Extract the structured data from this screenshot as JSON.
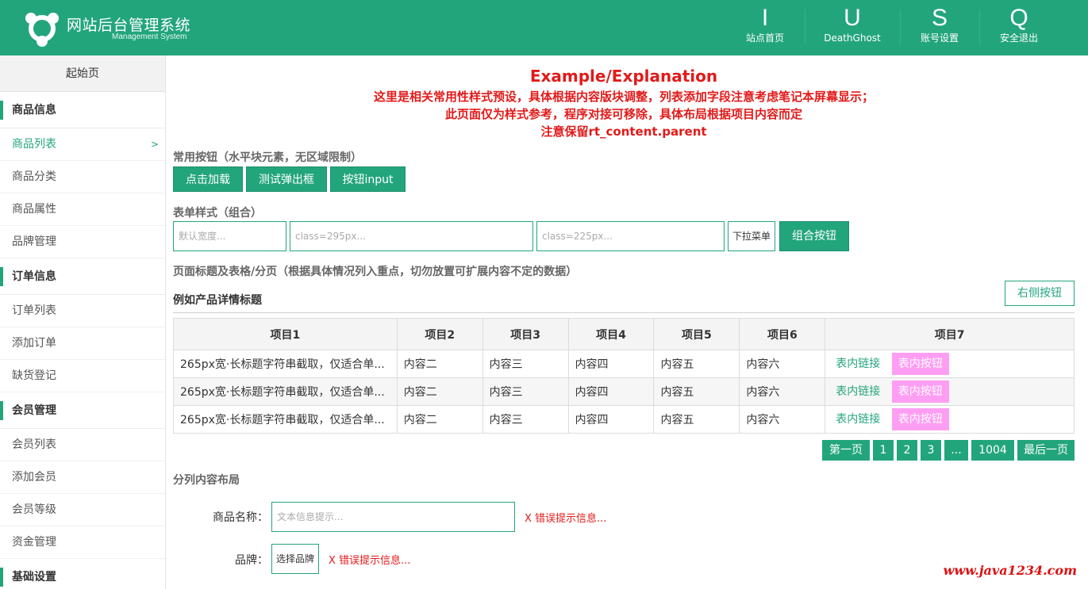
{
  "header": {
    "title": "网站后台管理系统",
    "subtitle": "Management System",
    "nav": [
      {
        "glyph": "I",
        "label": "站点首页",
        "icon": "home-icon"
      },
      {
        "glyph": "U",
        "label": "DeathGhost",
        "icon": "user-icon"
      },
      {
        "glyph": "S",
        "label": "账号设置",
        "icon": "settings-icon"
      },
      {
        "glyph": "Q",
        "label": "安全退出",
        "icon": "logout-icon"
      }
    ],
    "brand_color": "#23a57c"
  },
  "sidebar": {
    "home": "起始页",
    "groups": [
      {
        "title": "商品信息",
        "items": [
          "商品列表",
          "商品分类",
          "商品属性",
          "品牌管理"
        ]
      },
      {
        "title": "订单信息",
        "items": [
          "订单列表",
          "添加订单",
          "缺货登记"
        ]
      },
      {
        "title": "会员管理",
        "items": [
          "会员列表",
          "添加会员",
          "会员等级",
          "资金管理"
        ]
      },
      {
        "title": "基础设置",
        "items": []
      }
    ],
    "active_item": "商品列表",
    "active_arrow": ">"
  },
  "explanation": {
    "title": "Example/Explanation",
    "lines": [
      "这里是相关常用性样式预设，具体根据内容版块调整，列表添加字段注意考虑笔记本屏幕显示；",
      "此页面仅为样式参考，程序对接可移除，具体布局根据项目内容而定",
      "注意保留rt_content.parent"
    ]
  },
  "buttons_section": {
    "title": "常用按钮（水平块元素，无区域限制）",
    "buttons": [
      "点击加载",
      "测试弹出框",
      "按钮input"
    ]
  },
  "form_section": {
    "title": "表单样式（组合）",
    "placeholders": [
      "默认宽度...",
      "class=295px...",
      "class=225px..."
    ],
    "select_value": "下拉菜单",
    "group_button": "组合按钮"
  },
  "table_section": {
    "title": "页面标题及表格/分页（根据具体情况列入重点，切勿放置可扩展内容不定的数据）",
    "detail_title": "例如产品详情标题",
    "right_button": "右侧按钮",
    "columns": [
      "项目1",
      "项目2",
      "项目3",
      "项目4",
      "项目5",
      "项目6",
      "项目7"
    ],
    "rows": [
      {
        "c1": "265px宽·长标题字符串截取，仅适合单...",
        "c2": "内容二",
        "c3": "内容三",
        "c4": "内容四",
        "c5": "内容五",
        "c6": "内容六",
        "link": "表内链接",
        "button": "表内按钮"
      },
      {
        "c1": "265px宽·长标题字符串截取，仅适合单...",
        "c2": "内容二",
        "c3": "内容三",
        "c4": "内容四",
        "c5": "内容五",
        "c6": "内容六",
        "link": "表内链接",
        "button": "表内按钮"
      },
      {
        "c1": "265px宽·长标题字符串截取，仅适合单...",
        "c2": "内容二",
        "c3": "内容三",
        "c4": "内容四",
        "c5": "内容五",
        "c6": "内容六",
        "link": "表内链接",
        "button": "表内按钮"
      }
    ],
    "pagination": [
      "第一页",
      "1",
      "2",
      "3",
      "...",
      "1004",
      "最后一页"
    ],
    "pink_color": "#fe9ef3"
  },
  "column_section": {
    "title": "分列内容布局",
    "name_label": "商品名称：",
    "name_placeholder": "文本信息提示...",
    "name_error": "X 错误提示信息...",
    "brand_label": "品牌：",
    "brand_button": "选择品牌",
    "brand_error": "X 错误提示信息..."
  },
  "watermark": "www.java1234.com"
}
